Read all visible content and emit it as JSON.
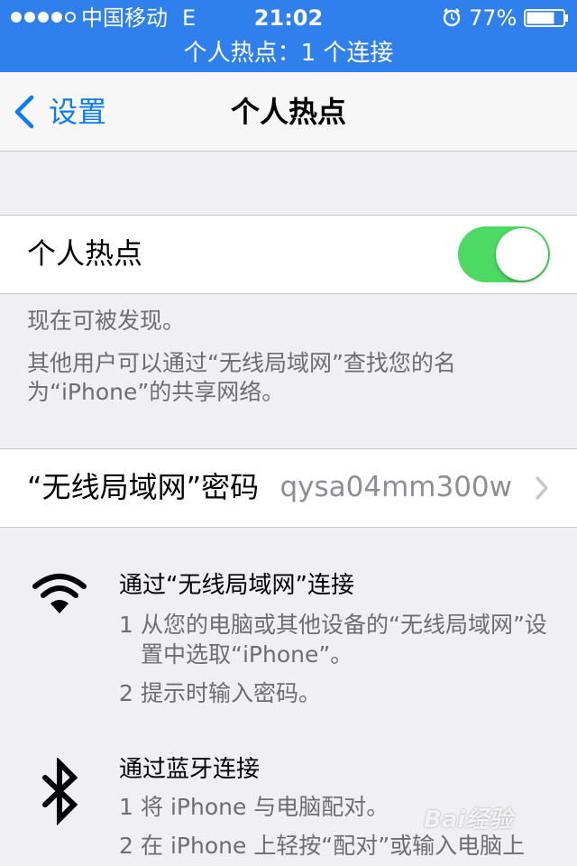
{
  "status_bar": {
    "carrier": "中国移动",
    "network": "E",
    "time": "21:02",
    "battery_percent": "77%",
    "battery_level": 0.77,
    "signal_bars_filled": 4,
    "signal_bars_total": 5,
    "icons": [
      "signal-dots-icon",
      "alarm-icon",
      "battery-icon"
    ]
  },
  "banner": {
    "text": "个人热点：1 个连接"
  },
  "nav": {
    "back_label": "设置",
    "title": "个人热点"
  },
  "hotspot_cell": {
    "label": "个人热点",
    "toggle_on": true
  },
  "footer": {
    "discoverable": "现在可被发现。",
    "description": "其他用户可以通过“无线局域网”查找您的名为“iPhone”的共享网络。"
  },
  "password_cell": {
    "label": "“无线局域网”密码",
    "value": "qysa04mm300w"
  },
  "instructions": {
    "wifi": {
      "title": "通过“无线局域网”连接",
      "steps": [
        {
          "num": "1",
          "text": "从您的电脑或其他设备的“无线局域网”设置中选取“iPhone”。"
        },
        {
          "num": "2",
          "text": "提示时输入密码。"
        }
      ]
    },
    "bluetooth": {
      "title": "通过蓝牙连接",
      "steps": [
        {
          "num": "1",
          "text": "将 iPhone 与电脑配对。"
        },
        {
          "num": "2",
          "text": "在 iPhone 上轻按“配对”或输入电脑上"
        }
      ]
    }
  },
  "watermark": {
    "text": "Bai经验"
  },
  "colors": {
    "status_bar_bg": "#2f80ed",
    "tint": "#0a7aff",
    "toggle_on": "#4cd964",
    "secondary_text": "#6d6d72",
    "background": "#efeff4"
  }
}
